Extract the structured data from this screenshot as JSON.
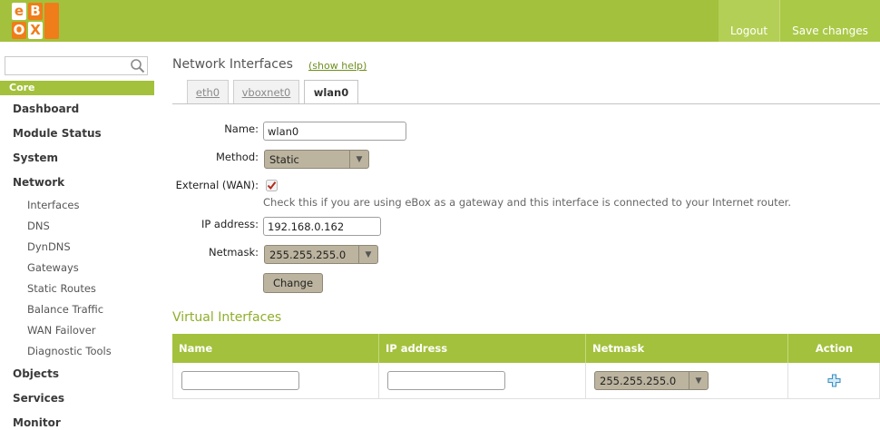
{
  "header": {
    "logo_letters": [
      "e",
      "B",
      "O",
      "X"
    ],
    "logout_label": "Logout",
    "save_label": "Save changes",
    "colors": {
      "brand_green": "#a3c13c",
      "logo_orange": "#ef7d1a"
    }
  },
  "sidebar": {
    "search_placeholder": "",
    "section": "Core",
    "items": [
      {
        "label": "Dashboard"
      },
      {
        "label": "Module Status"
      },
      {
        "label": "System"
      },
      {
        "label": "Network"
      }
    ],
    "network_children": [
      "Interfaces",
      "DNS",
      "DynDNS",
      "Gateways",
      "Static Routes",
      "Balance Traffic",
      "WAN Failover",
      "Diagnostic Tools"
    ],
    "items_after": [
      {
        "label": "Objects"
      },
      {
        "label": "Services"
      },
      {
        "label": "Monitor"
      }
    ]
  },
  "main": {
    "title": "Network Interfaces",
    "help_link": "(show help)",
    "tabs": [
      {
        "label": "eth0",
        "active": false
      },
      {
        "label": "vboxnet0",
        "active": false
      },
      {
        "label": "wlan0",
        "active": true
      }
    ],
    "form": {
      "name_label": "Name:",
      "name_value": "wlan0",
      "method_label": "Method:",
      "method_value": "Static",
      "external_label": "External (WAN):",
      "external_checked": true,
      "external_hint": "Check this if you are using eBox as a gateway and this interface is connected to your Internet router.",
      "ip_label": "IP address:",
      "ip_value": "192.168.0.162",
      "netmask_label": "Netmask:",
      "netmask_value": "255.255.255.0",
      "change_button": "Change"
    },
    "virtual": {
      "title": "Virtual Interfaces",
      "columns": [
        "Name",
        "IP address",
        "Netmask",
        "Action"
      ],
      "row": {
        "name": "",
        "ip": "",
        "netmask": "255.255.255.0",
        "action_icon": "add-icon"
      }
    }
  }
}
